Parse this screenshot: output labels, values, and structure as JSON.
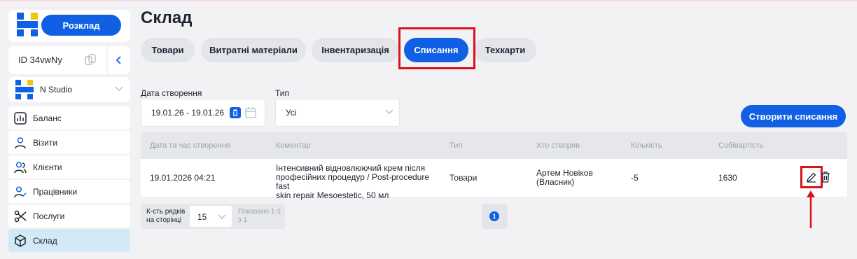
{
  "sidebar": {
    "schedule_label": "Розклад",
    "account_id": "ID 34vwNy",
    "studio_name": "N Studio",
    "nav": [
      {
        "label": "Баланс",
        "icon": "chart-icon"
      },
      {
        "label": "Візити",
        "icon": "user-icon"
      },
      {
        "label": "Клієнти",
        "icon": "users-icon"
      },
      {
        "label": "Працівники",
        "icon": "user-check-icon"
      },
      {
        "label": "Послуги",
        "icon": "scissors-icon"
      },
      {
        "label": "Склад",
        "icon": "box-icon"
      }
    ],
    "active_item": "Склад"
  },
  "page": {
    "title": "Склад",
    "tabs": [
      "Товари",
      "Витратні матеріали",
      "Інвентаризація",
      "Списання",
      "Техкарти"
    ],
    "active_tab": "Списання"
  },
  "filters": {
    "date_label": "Дата створення",
    "date_value": "19.01.26 - 19.01.26",
    "type_label": "Тип",
    "type_value": "Усі"
  },
  "actions": {
    "create_label": "Створити списання"
  },
  "table": {
    "headers": [
      "Дата та час створення",
      "Коментар",
      "Тип",
      "Хто створив",
      "Кількість",
      "Собівартість"
    ],
    "rows": [
      {
        "datetime": "19.01.2026 04:21",
        "comment_lines": [
          "Інтенсивний відновлюючий крем після",
          "професійних процедур / Post-procedure fast",
          "skin repair Mesoestetic, 50 мл"
        ],
        "type": "Товари",
        "creator_lines": [
          "Артем Новіков",
          "(Власник)"
        ],
        "quantity": "-5",
        "cost": "1630"
      }
    ]
  },
  "pagination": {
    "rows_label_lines": [
      "К-сть рядків",
      "на сторінці"
    ],
    "rows_value": "15",
    "shown_lines": [
      "Показано 1-1",
      "з 1"
    ],
    "current_page": "1"
  },
  "colors": {
    "accent": "#1160e4",
    "highlight": "#d9121c",
    "active_nav": "#d3e9f6"
  }
}
